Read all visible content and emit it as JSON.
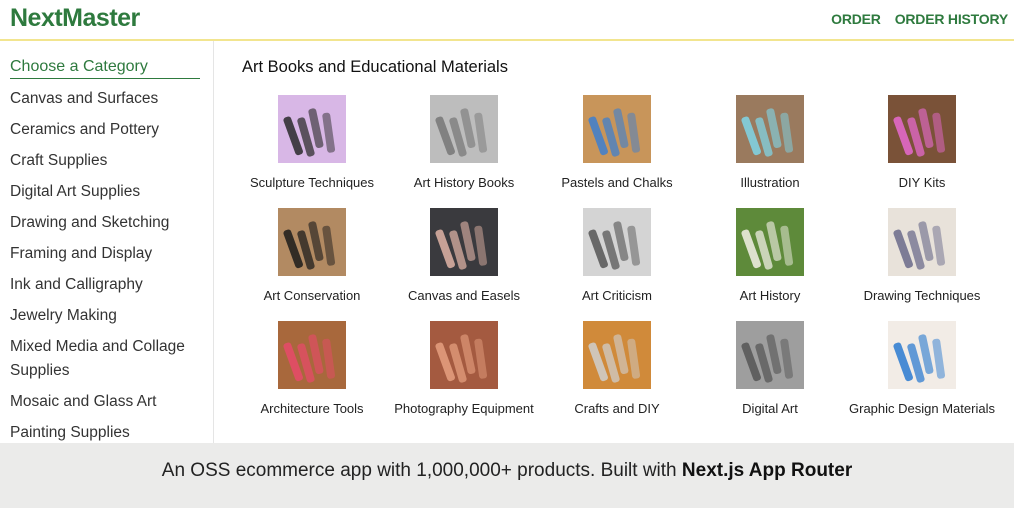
{
  "header": {
    "logo": "NextMaster",
    "nav": [
      {
        "label": "ORDER"
      },
      {
        "label": "ORDER HISTORY"
      }
    ]
  },
  "sidebar": {
    "heading": "Choose a Category",
    "items": [
      {
        "label": "Canvas and Surfaces"
      },
      {
        "label": "Ceramics and Pottery"
      },
      {
        "label": "Craft Supplies"
      },
      {
        "label": "Digital Art Supplies"
      },
      {
        "label": "Drawing and Sketching"
      },
      {
        "label": "Framing and Display"
      },
      {
        "label": "Ink and Calligraphy"
      },
      {
        "label": "Jewelry Making"
      },
      {
        "label": "Mixed Media and Collage Supplies"
      },
      {
        "label": "Mosaic and Glass Art"
      },
      {
        "label": "Painting Supplies"
      }
    ]
  },
  "main": {
    "title": "Art Books and Educational Materials",
    "tiles": [
      {
        "label": "Sculpture Techniques",
        "icon": "art-supplies-kit-image",
        "bg": "#d8b7e6",
        "fg": "#2a2a2a"
      },
      {
        "label": "Art History Books",
        "icon": "grey-tubes-image",
        "bg": "#bdbdbd",
        "fg": "#777777"
      },
      {
        "label": "Pastels and Chalks",
        "icon": "blue-pouch-image",
        "bg": "#c8955a",
        "fg": "#3d7fd0"
      },
      {
        "label": "Illustration",
        "icon": "water-cup-image",
        "bg": "#9a7a5e",
        "fg": "#7fd6e8"
      },
      {
        "label": "DIY Kits",
        "icon": "erasers-image",
        "bg": "#7a5238",
        "fg": "#e86ad0"
      },
      {
        "label": "Art Conservation",
        "icon": "brush-pens-image",
        "bg": "#b28a62",
        "fg": "#1b1b1b"
      },
      {
        "label": "Canvas and Easels",
        "icon": "rose-pen-image",
        "bg": "#3a3a3e",
        "fg": "#e0b4a6"
      },
      {
        "label": "Art Criticism",
        "icon": "fountain-pen-image",
        "bg": "#d4d4d4",
        "fg": "#555555"
      },
      {
        "label": "Art History",
        "icon": "easel-image",
        "bg": "#5e8a3a",
        "fg": "#f3f0e8"
      },
      {
        "label": "Drawing Techniques",
        "icon": "pens-on-paper-image",
        "bg": "#e8e2da",
        "fg": "#6a6a8a"
      },
      {
        "label": "Architecture Tools",
        "icon": "colored-pencils-image",
        "bg": "#a8683c",
        "fg": "#e84a6a"
      },
      {
        "label": "Photography Equipment",
        "icon": "copper-wire-image",
        "bg": "#a45a40",
        "fg": "#e6a080"
      },
      {
        "label": "Crafts and DIY",
        "icon": "metal-tubes-image",
        "bg": "#d08a3a",
        "fg": "#cfcfcf"
      },
      {
        "label": "Digital Art",
        "icon": "striped-rods-image",
        "bg": "#9e9e9e",
        "fg": "#555555"
      },
      {
        "label": "Graphic Design Materials",
        "icon": "supplies-bottles-image",
        "bg": "#f2ece6",
        "fg": "#2a7ad0"
      }
    ]
  },
  "footer": {
    "text": "An OSS ecommerce app with 1,000,000+ products. Built with",
    "bold": "Next.js App Router"
  }
}
